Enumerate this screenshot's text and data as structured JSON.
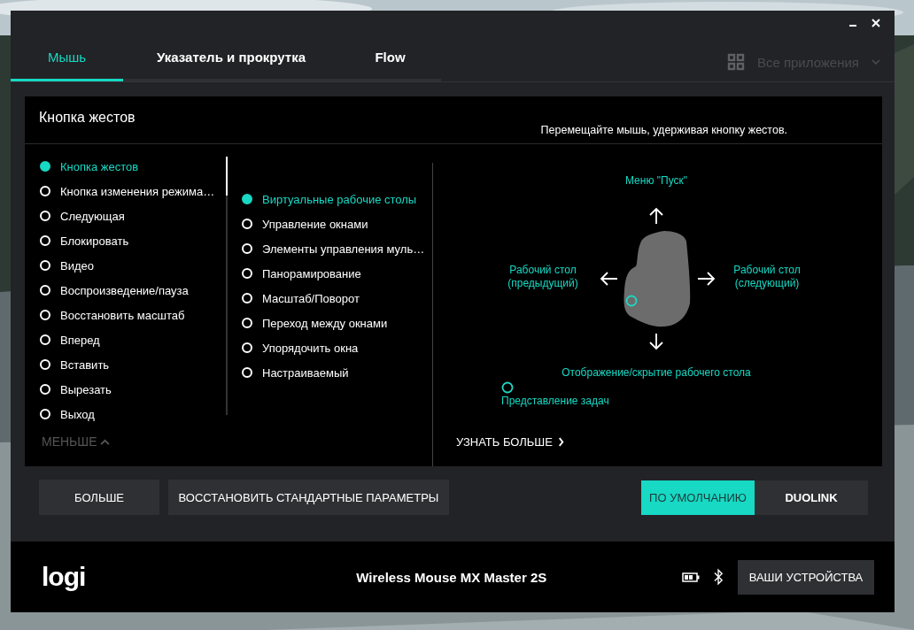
{
  "tabs": [
    {
      "label": "Мышь",
      "selected": true
    },
    {
      "label": "Указатель и прокрутка",
      "selected": false
    },
    {
      "label": "Flow",
      "selected": false
    }
  ],
  "app_filter": {
    "label": "Все приложения"
  },
  "panel": {
    "title": "Кнопка жестов",
    "hint": "Перемещайте мышь, удерживая кнопку жестов.",
    "buttons": [
      {
        "label": "Кнопка жестов",
        "selected": true
      },
      {
        "label": "Кнопка изменения режима…",
        "selected": false
      },
      {
        "label": "Следующая",
        "selected": false
      },
      {
        "label": "Блокировать",
        "selected": false
      },
      {
        "label": "Видео",
        "selected": false
      },
      {
        "label": "Воспроизведение/пауза",
        "selected": false
      },
      {
        "label": "Восстановить масштаб",
        "selected": false
      },
      {
        "label": "Вперед",
        "selected": false
      },
      {
        "label": "Вставить",
        "selected": false
      },
      {
        "label": "Вырезать",
        "selected": false
      },
      {
        "label": "Выход",
        "selected": false
      }
    ],
    "less_link": "МЕНЬШЕ",
    "actions": [
      {
        "label": "Виртуальные рабочие столы",
        "selected": true
      },
      {
        "label": "Управление окнами",
        "selected": false
      },
      {
        "label": "Элементы управления муль…",
        "selected": false
      },
      {
        "label": "Панорамирование",
        "selected": false
      },
      {
        "label": "Масштаб/Поворот",
        "selected": false
      },
      {
        "label": "Переход между окнами",
        "selected": false
      },
      {
        "label": "Упорядочить окна",
        "selected": false
      },
      {
        "label": "Настраиваемый",
        "selected": false
      }
    ],
    "gestures": {
      "up": "Меню \"Пуск\"",
      "left": "Рабочий стол (предыдущий)",
      "right": "Рабочий стол (следующий)",
      "down": "Отображение/скрытие рабочего стола",
      "click": "Представление задач"
    },
    "learn_more": "УЗНАТЬ БОЛЬШЕ"
  },
  "buttons": [
    "БОЛЬШЕ",
    "ВОССТАНОВИТЬ СТАНДАРТНЫЕ ПАРАМЕТРЫ"
  ],
  "modes": [
    {
      "label": "ПО УМОЛЧАНИЮ",
      "selected": true
    },
    {
      "label": "DUOLINK",
      "selected": false
    }
  ],
  "footer": {
    "logo": "logi",
    "device": "Wireless Mouse MX Master 2S",
    "devices_button": "ВАШИ УСТРОЙСТВА"
  }
}
